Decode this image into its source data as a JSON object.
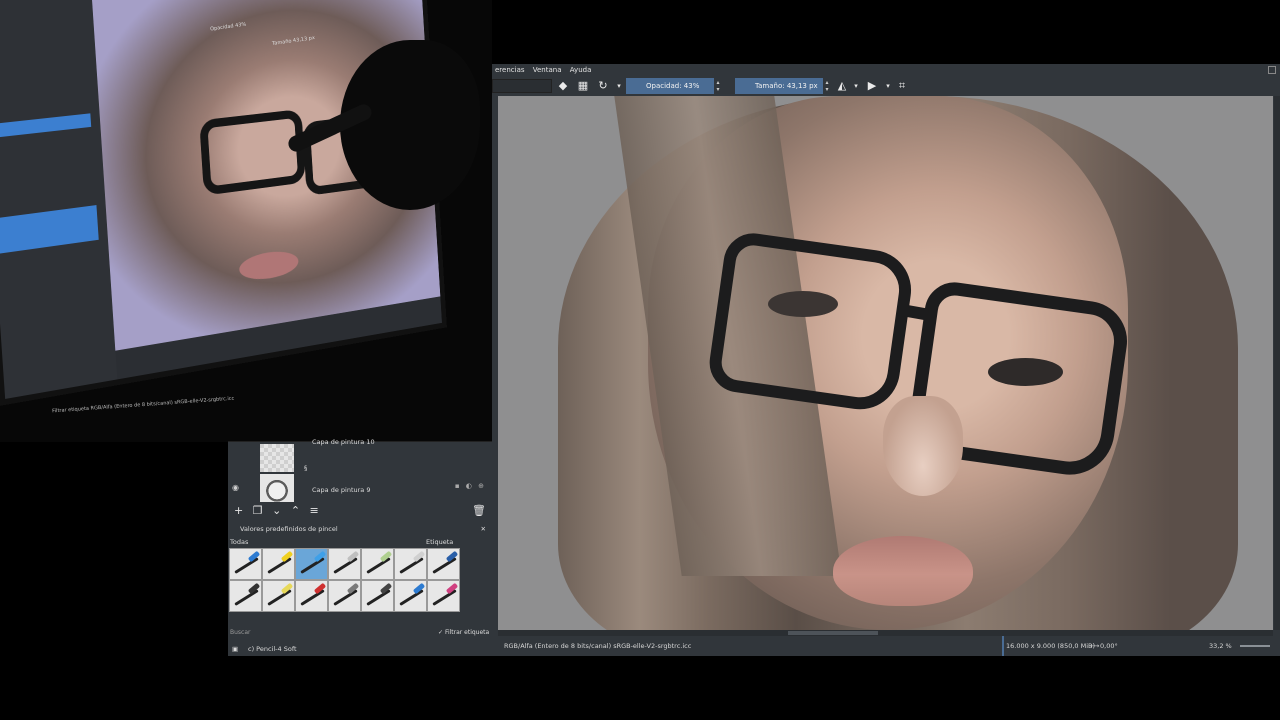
{
  "camera": {
    "status_text": "RGB/Alfa (Entero de 8 bits/canal)  sRGB-elle-V2-srgbtrc.icc",
    "opacity_text": "Opacidad 43%",
    "size_text": "Tamaño 43,13 px",
    "filter_label": "Filtrar etiqueta"
  },
  "menubar": {
    "items": [
      "erencias",
      "Ventana",
      "Ayuda"
    ]
  },
  "toolbar": {
    "opacity": "Opacidad: 43%",
    "size": "Tamaño: 43,13 px"
  },
  "canvas": {
    "subject": "painting"
  },
  "statusbar": {
    "brush": "c) Pencil-4 Soft",
    "color_info": "RGB/Alfa (Entero de 8 bits/canal)  sRGB-elle-V2-srgbtrc.icc",
    "dimensions": "16.000 x 9.000 (850,0 MiB)",
    "rotation": "0,00°",
    "zoom": "33,2 %"
  },
  "layers": {
    "items": [
      {
        "name": "Capa de pintura 10"
      },
      {
        "name": ""
      },
      {
        "name": "Capa de pintura 9"
      }
    ]
  },
  "presets": {
    "title": "Valores predefinidos de pincel",
    "filter_all": "Todas",
    "tag_label": "Etiqueta",
    "search_placeholder": "Buscar",
    "filter_tag": "Filtrar etiqueta",
    "brush_tips": [
      "#2d7bd1",
      "#f0d020",
      "#3fa0e8",
      "#c0c0c0",
      "#b0d090",
      "#d0d0d0",
      "#2a5fa8",
      "#333333",
      "#e7d95a",
      "#cf3030",
      "#7a7a7a",
      "#444444",
      "#2d7bd1",
      "#d04080"
    ]
  }
}
